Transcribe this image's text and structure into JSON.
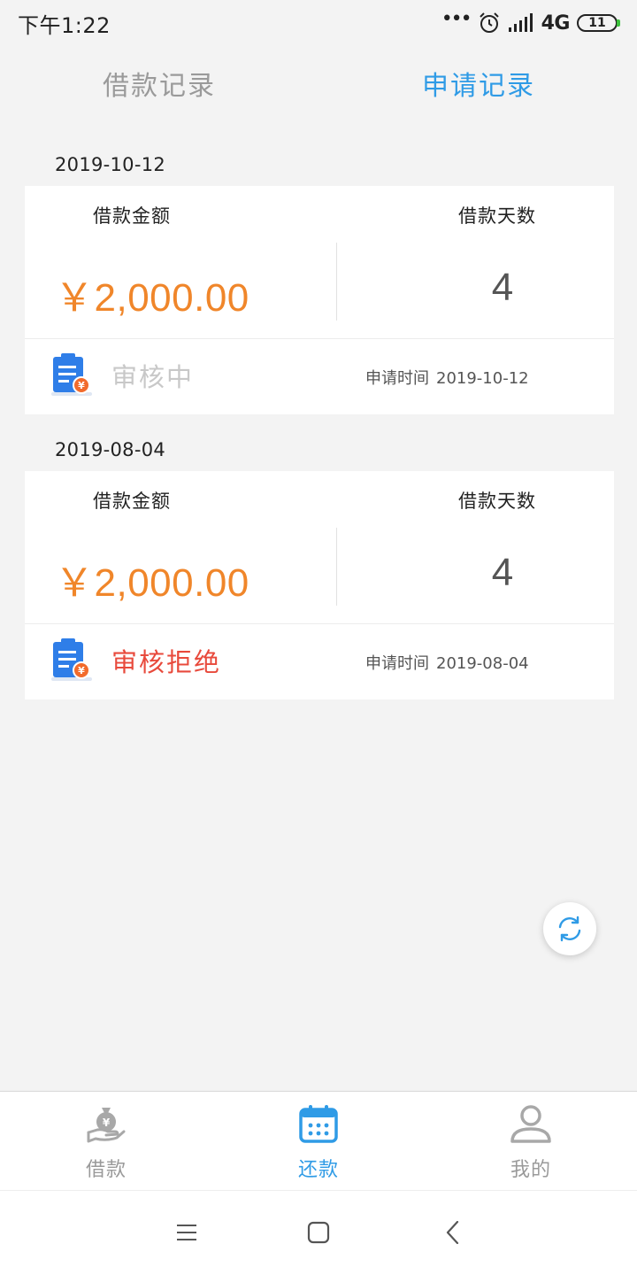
{
  "status_bar": {
    "time": "下午1:22",
    "dots": "•••",
    "network": "4G",
    "battery": "11"
  },
  "tabs": [
    {
      "label": "借款记录",
      "active": false
    },
    {
      "label": "申请记录",
      "active": true
    }
  ],
  "records": [
    {
      "date": "2019-10-12",
      "amount_label": "借款金额",
      "amount": "￥2,000.00",
      "days_label": "借款天数",
      "days": "4",
      "status": "审核中",
      "status_color": "#c8c8c8",
      "apply_time_label": "申请时间",
      "apply_time": "2019-10-12"
    },
    {
      "date": "2019-08-04",
      "amount_label": "借款金额",
      "amount": "￥2,000.00",
      "days_label": "借款天数",
      "days": "4",
      "status": "审核拒绝",
      "status_color": "#e84a3c",
      "apply_time_label": "申请时间",
      "apply_time": "2019-08-04"
    }
  ],
  "bottom_nav": [
    {
      "label": "借款",
      "icon": "money-bag-hand-icon",
      "active": false
    },
    {
      "label": "还款",
      "icon": "calendar-icon",
      "active": true
    },
    {
      "label": "我的",
      "icon": "user-icon",
      "active": false
    }
  ],
  "colors": {
    "accent": "#2f9be6",
    "amount": "#f0862a",
    "rejected": "#e84a3c",
    "pending": "#c8c8c8",
    "inactive": "#9a9a9a"
  }
}
